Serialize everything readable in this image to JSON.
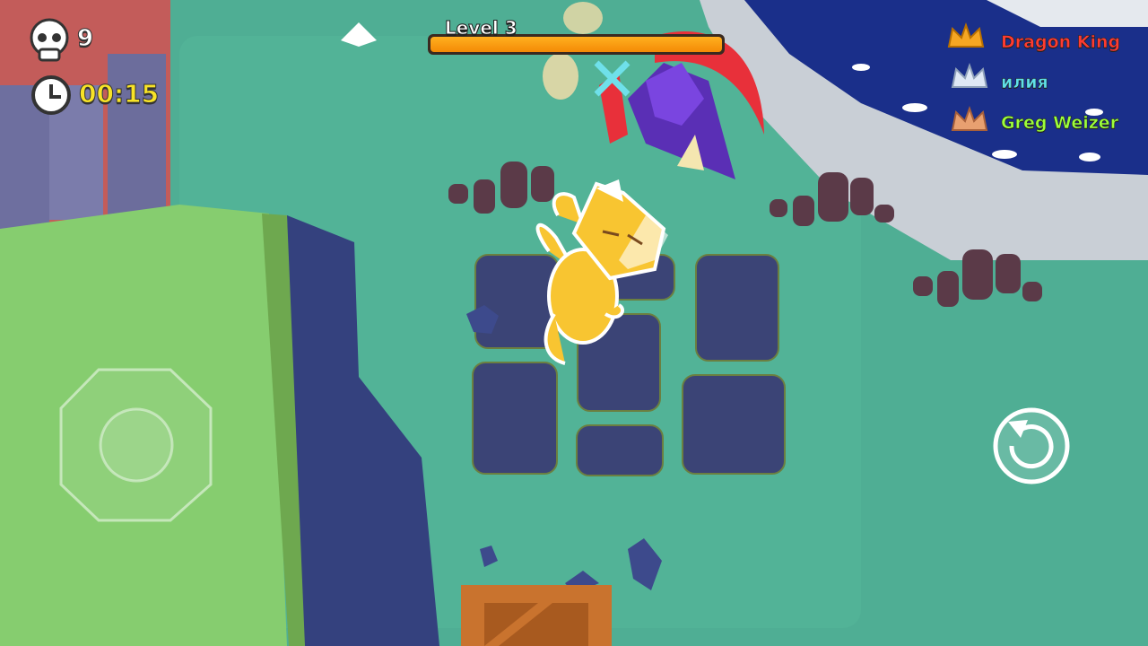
{
  "hud": {
    "kills": "9",
    "timer": "00:15",
    "skull_icon": "skull-icon",
    "clock_icon": "clock-icon"
  },
  "level": {
    "label": "Level 3",
    "progress": 1.0
  },
  "leaderboard": [
    {
      "name": "Dragon King",
      "color": "#ff3b30",
      "crown_color": "#f5a623",
      "crown_icon": "gold-crown-icon"
    },
    {
      "name": "илия",
      "color": "#5fe0e8",
      "crown_color": "#dfe8f5",
      "crown_icon": "silver-crown-icon"
    },
    {
      "name": "Greg Weizer",
      "color": "#9cff3a",
      "crown_color": "#e8a070",
      "crown_icon": "bronze-crown-icon"
    }
  ],
  "controls": {
    "joystick_icon": "joystick-icon",
    "action_icon": "undo-arrow-icon"
  },
  "colors": {
    "ground": "#4fae94",
    "cliff_top": "#86cd6f",
    "cliff_face": "#34417e",
    "water": "#1a2f8a",
    "tiles": "#3b4476",
    "player": "#f8c531"
  }
}
